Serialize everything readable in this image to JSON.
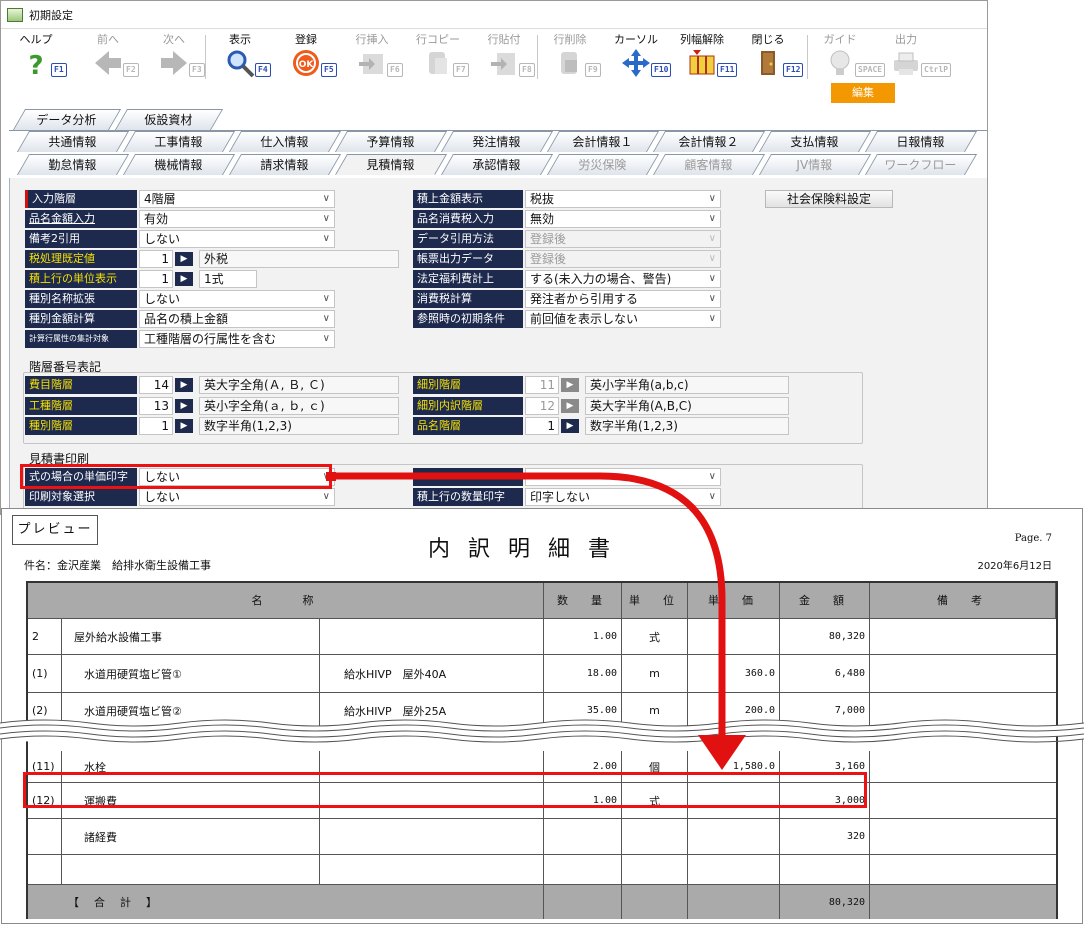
{
  "window": {
    "title": "初期設定"
  },
  "toolbar": {
    "buttons": [
      {
        "label": "ヘルプ",
        "key": "F1",
        "icon": "help-icon",
        "enabled": true
      },
      {
        "label": "前へ",
        "key": "F2",
        "icon": "back-arrow-icon",
        "enabled": false
      },
      {
        "label": "次へ",
        "key": "F3",
        "icon": "forward-arrow-icon",
        "enabled": false
      },
      {
        "label": "表示",
        "key": "F4",
        "icon": "magnifier-icon",
        "enabled": true
      },
      {
        "label": "登録",
        "key": "F5",
        "icon": "ok-icon",
        "enabled": true
      },
      {
        "label": "行挿入",
        "key": "F6",
        "icon": "row-insert-icon",
        "enabled": false
      },
      {
        "label": "行コピー",
        "key": "F7",
        "icon": "row-copy-icon",
        "enabled": false
      },
      {
        "label": "行貼付",
        "key": "F8",
        "icon": "row-paste-icon",
        "enabled": false
      },
      {
        "label": "行削除",
        "key": "F9",
        "icon": "row-delete-icon",
        "enabled": false
      },
      {
        "label": "カーソル",
        "key": "F10",
        "icon": "cursor-move-icon",
        "enabled": true
      },
      {
        "label": "列幅解除",
        "key": "F11",
        "icon": "column-width-icon",
        "enabled": true
      },
      {
        "label": "閉じる",
        "key": "F12",
        "icon": "door-close-icon",
        "enabled": true
      },
      {
        "label": "ガイド",
        "key": "SPACE",
        "icon": "lightbulb-icon",
        "enabled": false
      },
      {
        "label": "出力",
        "key": "CtrlP",
        "icon": "printer-icon",
        "enabled": false
      }
    ],
    "mode_badge": "編集"
  },
  "tabs": {
    "row1": [
      "データ分析",
      "仮設資材"
    ],
    "row2": [
      "共通情報",
      "工事情報",
      "仕入情報",
      "予算情報",
      "発注情報",
      "会計情報１",
      "会計情報２",
      "支払情報",
      "日報情報"
    ],
    "row3": [
      "勤怠情報",
      "機械情報",
      "請求情報",
      "見積情報",
      "承認情報",
      "労災保険",
      "顧客情報",
      "JV情報",
      "ワークフロー"
    ],
    "active": "見積情報"
  },
  "settings_left": [
    {
      "label": "入力階層",
      "value": "4階層"
    },
    {
      "label": "品名金額入力",
      "value": "有効"
    },
    {
      "label": "備考2引用",
      "value": "しない"
    },
    {
      "label": "税処理既定値",
      "num": "1",
      "text": "外税"
    },
    {
      "label": "積上行の単位表示",
      "num": "1",
      "text": "1式"
    },
    {
      "label": "種別名称拡張",
      "value": "しない"
    },
    {
      "label": "種別金額計算",
      "value": "品名の積上金額"
    },
    {
      "label": "計算行属性の集計対象",
      "value": "工種階層の行属性を含む"
    }
  ],
  "settings_right": [
    {
      "label": "積上金額表示",
      "value": "税抜"
    },
    {
      "label": "品名消費税入力",
      "value": "無効"
    },
    {
      "label": "データ引用方法",
      "value": "登録後"
    },
    {
      "label": "帳票出力データ",
      "value": "登録後"
    },
    {
      "label": "法定福利費計上",
      "value": "する(未入力の場合、警告)"
    },
    {
      "label": "消費税計算",
      "value": "発注者から引用する"
    },
    {
      "label": "参照時の初期条件",
      "value": "前回値を表示しない"
    }
  ],
  "social_insurance_button": "社会保険料設定",
  "hierarchy": {
    "title": "階層番号表記",
    "left": [
      {
        "label": "費目階層",
        "num": "14",
        "text": "英大字全角(Ａ, Ｂ, Ｃ)"
      },
      {
        "label": "工種階層",
        "num": "13",
        "text": "英小字全角(ａ, ｂ, ｃ)"
      },
      {
        "label": "種別階層",
        "num": "1",
        "text": "数字半角(1,2,3)"
      }
    ],
    "right": [
      {
        "label": "細別階層",
        "num": "11",
        "text": "英小字半角(a,b,c)"
      },
      {
        "label": "細別内訳階層",
        "num": "12",
        "text": "英大字半角(A,B,C)"
      },
      {
        "label": "品名階層",
        "num": "1",
        "text": "数字半角(1,2,3)"
      }
    ]
  },
  "estimate_print": {
    "title": "見積書印刷",
    "rows": [
      {
        "label": "式の場合の単価印字",
        "value": "しない"
      },
      {
        "label": "印刷対象選択",
        "value": "しない"
      }
    ],
    "right_rows": [
      {
        "label": "",
        "value": ""
      },
      {
        "label": "積上行の数量印字",
        "value": "印字しない"
      }
    ]
  },
  "preview": {
    "button": "プレビュー",
    "title": "内訳明細書",
    "subject": "件名：金沢産業　給排水衛生設備工事",
    "page": "Page. 7",
    "date": "2020年6月12日",
    "headers": [
      "名　　称",
      "数　量",
      "単　位",
      "単　価",
      "金　額",
      "備　考"
    ],
    "rows": [
      {
        "no": "2",
        "name": "屋外給水設備工事",
        "spec": "",
        "qty": "1.00",
        "unit": "式",
        "price": "",
        "amount": "80,320"
      },
      {
        "no": "(1)",
        "name": "水道用硬質塩ビ管①",
        "spec": "給水HIVP　屋外40A",
        "qty": "18.00",
        "unit": "m",
        "price": "360.0",
        "amount": "6,480"
      },
      {
        "no": "(2)",
        "name": "水道用硬質塩ビ管②",
        "spec": "給水HIVP　屋外25A",
        "qty": "35.00",
        "unit": "m",
        "price": "200.0",
        "amount": "7,000"
      },
      {
        "no": "(11)",
        "name": "水栓",
        "spec": "",
        "qty": "2.00",
        "unit": "個",
        "price": "1,580.0",
        "amount": "3,160"
      },
      {
        "no": "(12)",
        "name": "運搬費",
        "spec": "",
        "qty": "1.00",
        "unit": "式",
        "price": "",
        "amount": "3,000"
      },
      {
        "no": "",
        "name": "諸経費",
        "spec": "",
        "qty": "",
        "unit": "",
        "price": "",
        "amount": "320"
      },
      {
        "no": "",
        "name": "",
        "spec": "",
        "qty": "",
        "unit": "",
        "price": "",
        "amount": ""
      }
    ],
    "total_label": "【　合　計　】",
    "total_amount": "80,320"
  },
  "colors": {
    "label_bg": "#1d2a4d",
    "highlight": "#e11111",
    "badge": "#f39800",
    "fkey": "#2a4eb3"
  }
}
